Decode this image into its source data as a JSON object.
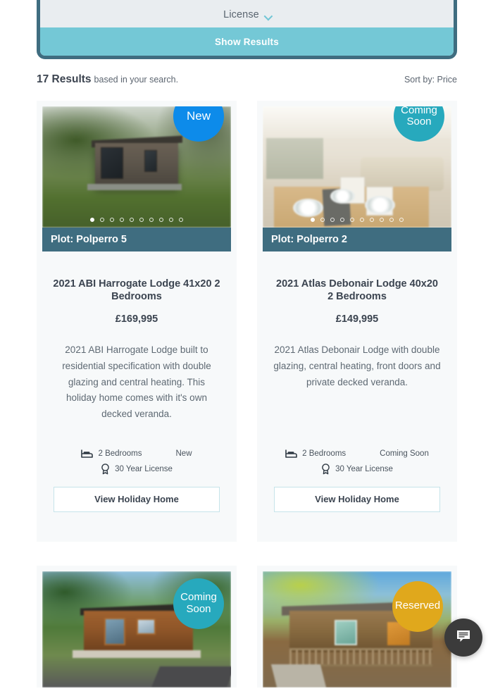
{
  "filter_panel": {
    "license_label": "License",
    "chevron_icon": "chevron-down-icon",
    "show_results_label": "Show Results"
  },
  "results_bar": {
    "count_label": "17 Results",
    "count_sub": "based in your search.",
    "sort_label": "Sort by: Price"
  },
  "colors": {
    "badge_new": "#0d8bea",
    "badge_coming_soon": "#27a9bd",
    "badge_reserved": "#e0a81c",
    "plot_bar": "#3f6d80",
    "show_results": "#74c8d6",
    "panel_border": "#3f6d80",
    "panel_fill": "#e9edf0",
    "card_bg": "#f7f9fa",
    "button_border": "#c6e4ea",
    "chat_bubble": "#3b3b3b"
  },
  "cards": [
    {
      "badge": "New",
      "badge_type": "new",
      "plot_label": "Plot: Polperro 5",
      "title": "2021 ABI Harrogate Lodge 41x20 2 Bedrooms",
      "price": "£169,995",
      "description": "2021 ABI Harrogate Lodge built to residential specification with double glazing and central heating. This holiday home comes with it's own decked veranda.",
      "bedrooms": "2 Bedrooms",
      "status": "New",
      "license": "30 Year License",
      "button_label": "View Holiday Home",
      "dots_total": 10,
      "dots_active": 1,
      "bed_icon": "bed-icon",
      "license_icon": "award-ribbon-icon"
    },
    {
      "badge": "Coming Soon",
      "badge_type": "coming",
      "plot_label": "Plot: Polperro 2",
      "title": "2021 Atlas Debonair Lodge 40x20 2 Bedrooms",
      "price": "£149,995",
      "description": "2021 Atlas Debonair Lodge with double glazing, central heating, front doors and private decked veranda.",
      "bedrooms": "2 Bedrooms",
      "status": "Coming Soon",
      "license": "30 Year License",
      "button_label": "View Holiday Home",
      "dots_total": 10,
      "dots_active": 1,
      "bed_icon": "bed-icon",
      "license_icon": "award-ribbon-icon"
    },
    {
      "badge": "Coming Soon",
      "badge_type": "coming"
    },
    {
      "badge": "Reserved",
      "badge_type": "reserved"
    }
  ],
  "chat_widget": {
    "icon": "chat-bubble-icon"
  }
}
